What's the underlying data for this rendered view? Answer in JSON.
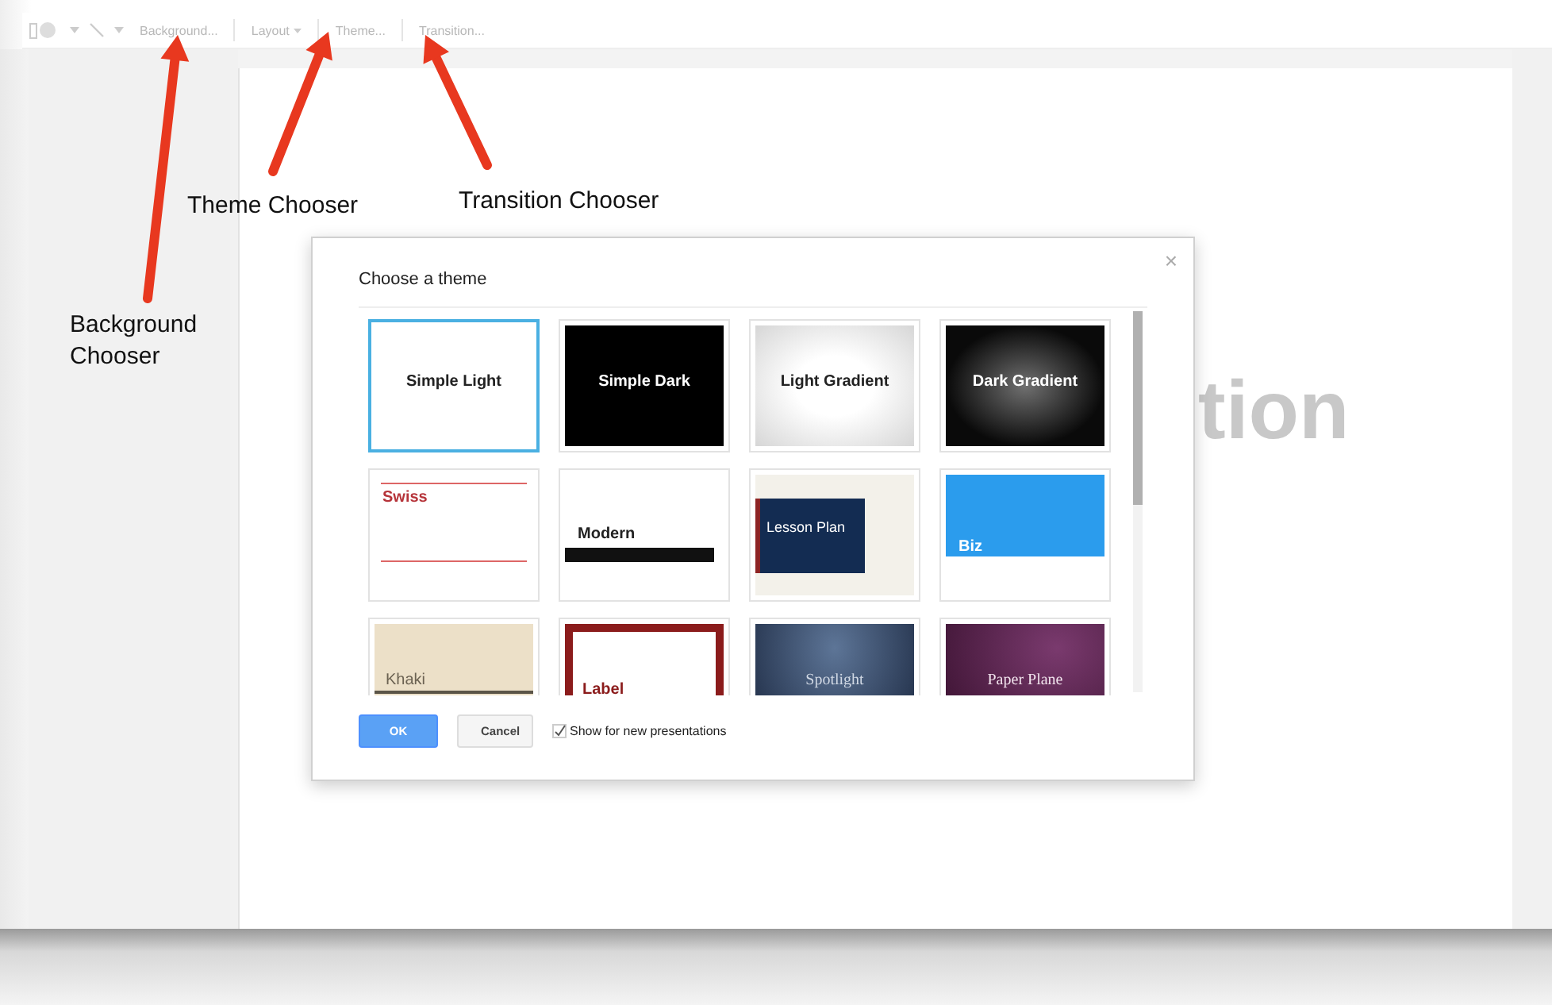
{
  "toolbar": {
    "items": [
      {
        "label": "Background...",
        "dropdown": false
      },
      {
        "label": "Layout",
        "dropdown": true
      },
      {
        "label": "Theme...",
        "dropdown": false
      },
      {
        "label": "Transition...",
        "dropdown": false
      }
    ]
  },
  "slide": {
    "title_fragment": "tion"
  },
  "dialog": {
    "title": "Choose a theme",
    "close": "×",
    "themes": [
      {
        "name": "Simple Light",
        "kind": "simple-light",
        "selected": true
      },
      {
        "name": "Simple Dark",
        "kind": "simple-dark",
        "selected": false
      },
      {
        "name": "Light Gradient",
        "kind": "light-gradient",
        "selected": false
      },
      {
        "name": "Dark Gradient",
        "kind": "dark-gradient",
        "selected": false
      },
      {
        "name": "Swiss",
        "kind": "swiss",
        "selected": false
      },
      {
        "name": "Modern",
        "kind": "modern",
        "selected": false
      },
      {
        "name": "Lesson Plan",
        "kind": "lesson-plan",
        "selected": false
      },
      {
        "name": "Biz",
        "kind": "biz",
        "selected": false
      },
      {
        "name": "Khaki",
        "kind": "khaki",
        "selected": false
      },
      {
        "name": "Label",
        "kind": "label",
        "selected": false
      },
      {
        "name": "Spotlight",
        "kind": "spotlight",
        "selected": false
      },
      {
        "name": "Paper Plane",
        "kind": "paper-plane",
        "selected": false
      }
    ],
    "buttons": [
      {
        "label": "OK",
        "primary": true
      },
      {
        "label": "Cancel",
        "primary": false
      }
    ],
    "show_for_new": {
      "label": "Show for new presentations",
      "checked": true
    }
  },
  "annotations": [
    {
      "text": "Theme Chooser"
    },
    {
      "text": "Transition Chooser"
    },
    {
      "text": "Background Chooser"
    }
  ]
}
